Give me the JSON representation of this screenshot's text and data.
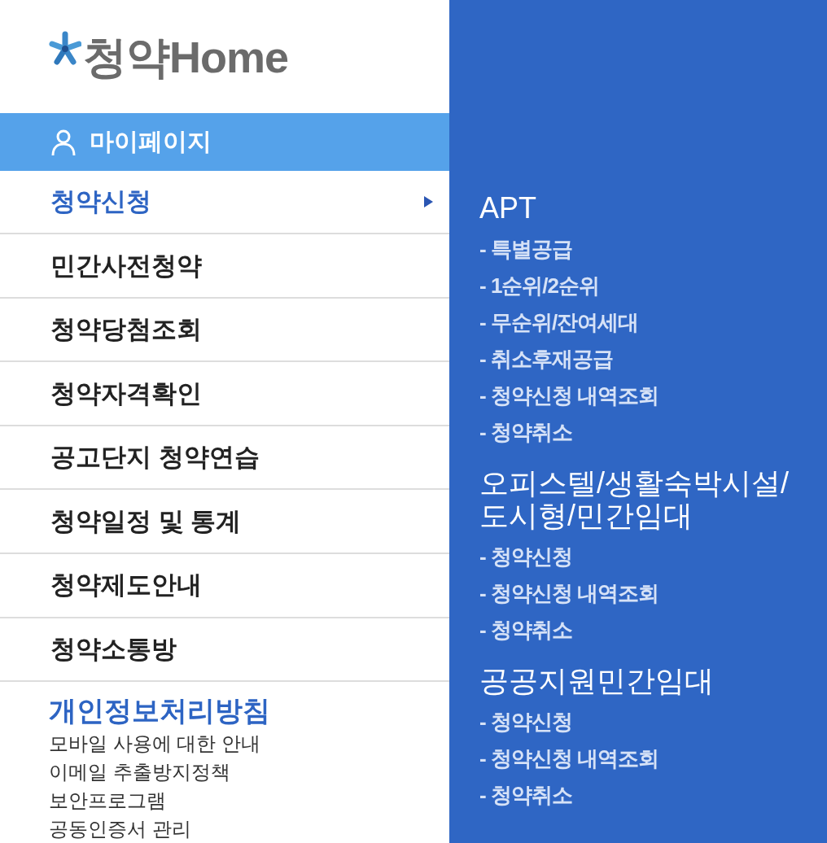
{
  "logo": {
    "text": "청약Home"
  },
  "mypage": {
    "label": "마이페이지"
  },
  "menu": [
    {
      "label": "청약신청",
      "selected": true
    },
    {
      "label": "민간사전청약",
      "selected": false
    },
    {
      "label": "청약당첨조회",
      "selected": false
    },
    {
      "label": "청약자격확인",
      "selected": false
    },
    {
      "label": "공고단지 청약연습",
      "selected": false
    },
    {
      "label": "청약일정 및 통계",
      "selected": false
    },
    {
      "label": "청약제도안내",
      "selected": false
    },
    {
      "label": "청약소통방",
      "selected": false
    }
  ],
  "footer_links": [
    {
      "label": "개인정보처리방침",
      "kind": "emphasis"
    },
    {
      "label": "모바일 사용에 대한 안내",
      "kind": "plain"
    },
    {
      "label": "이메일 추출방지정책",
      "kind": "plain"
    },
    {
      "label": "보안프로그램",
      "kind": "plain"
    },
    {
      "label": "공동인증서 관리",
      "kind": "plain"
    }
  ],
  "submenu": {
    "sections": [
      {
        "title": "APT",
        "items": [
          "- 특별공급",
          "- 1순위/2순위",
          "- 무순위/잔여세대",
          "- 취소후재공급",
          "- 청약신청 내역조회",
          "- 청약취소"
        ]
      },
      {
        "title": "오피스텔/생활숙박시설/도시형/민간임대",
        "items": [
          "- 청약신청",
          "- 청약신청 내역조회",
          "- 청약취소"
        ]
      },
      {
        "title": "공공지원민간임대",
        "items": [
          "- 청약신청",
          "- 청약신청 내역조회",
          "- 청약취소"
        ]
      }
    ]
  }
}
